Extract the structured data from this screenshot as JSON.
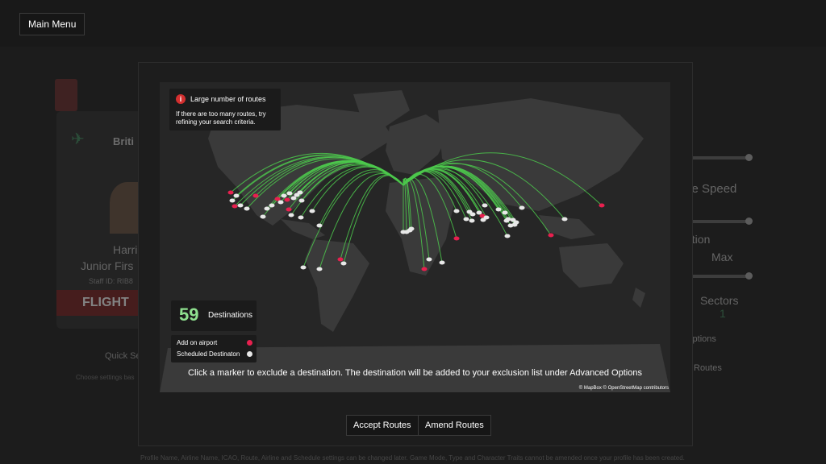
{
  "header": {
    "main_menu_label": "Main Menu"
  },
  "background": {
    "card": {
      "airline": "Briti",
      "name": "Harri",
      "rank": "Junior Firs",
      "staff_id": "Staff ID: RIB8",
      "status": "FLIGHT"
    },
    "quick_settings": "Quick Se",
    "quick_settings_sub": "Choose settings bas",
    "right_panel": {
      "cruise_speed": "se Speed",
      "duration": "ation",
      "max": "Max",
      "sectors": "Sectors",
      "sectors_value": "1",
      "options": "Options",
      "routes": "Routes"
    },
    "footer_note": "Profile Name, Airline Name, ICAO, Route, Airline and Schedule settings can be changed later. Game Mode, Type and Character Traits cannot be amended once your profile has been created."
  },
  "modal": {
    "warning": {
      "icon": "info-icon",
      "title": "Large number of routes",
      "body": "If there are too many routes, try refining your search criteria."
    },
    "destinations": {
      "count": "59",
      "label": "Destinations"
    },
    "legend": {
      "add_on": "Add on airport",
      "scheduled": "Scheduled Destinaton",
      "add_on_color": "#e8204f",
      "scheduled_color": "#e8e8e8"
    },
    "instruction": "Click a marker to exclude a destination. The destination will be added to your exclusion list under Advanced Options",
    "attribution": "© MapBox © OpenStreetMap contributors",
    "route_color": "#4cc84c",
    "accept_label": "Accept Routes",
    "amend_label": "Amend Routes"
  }
}
